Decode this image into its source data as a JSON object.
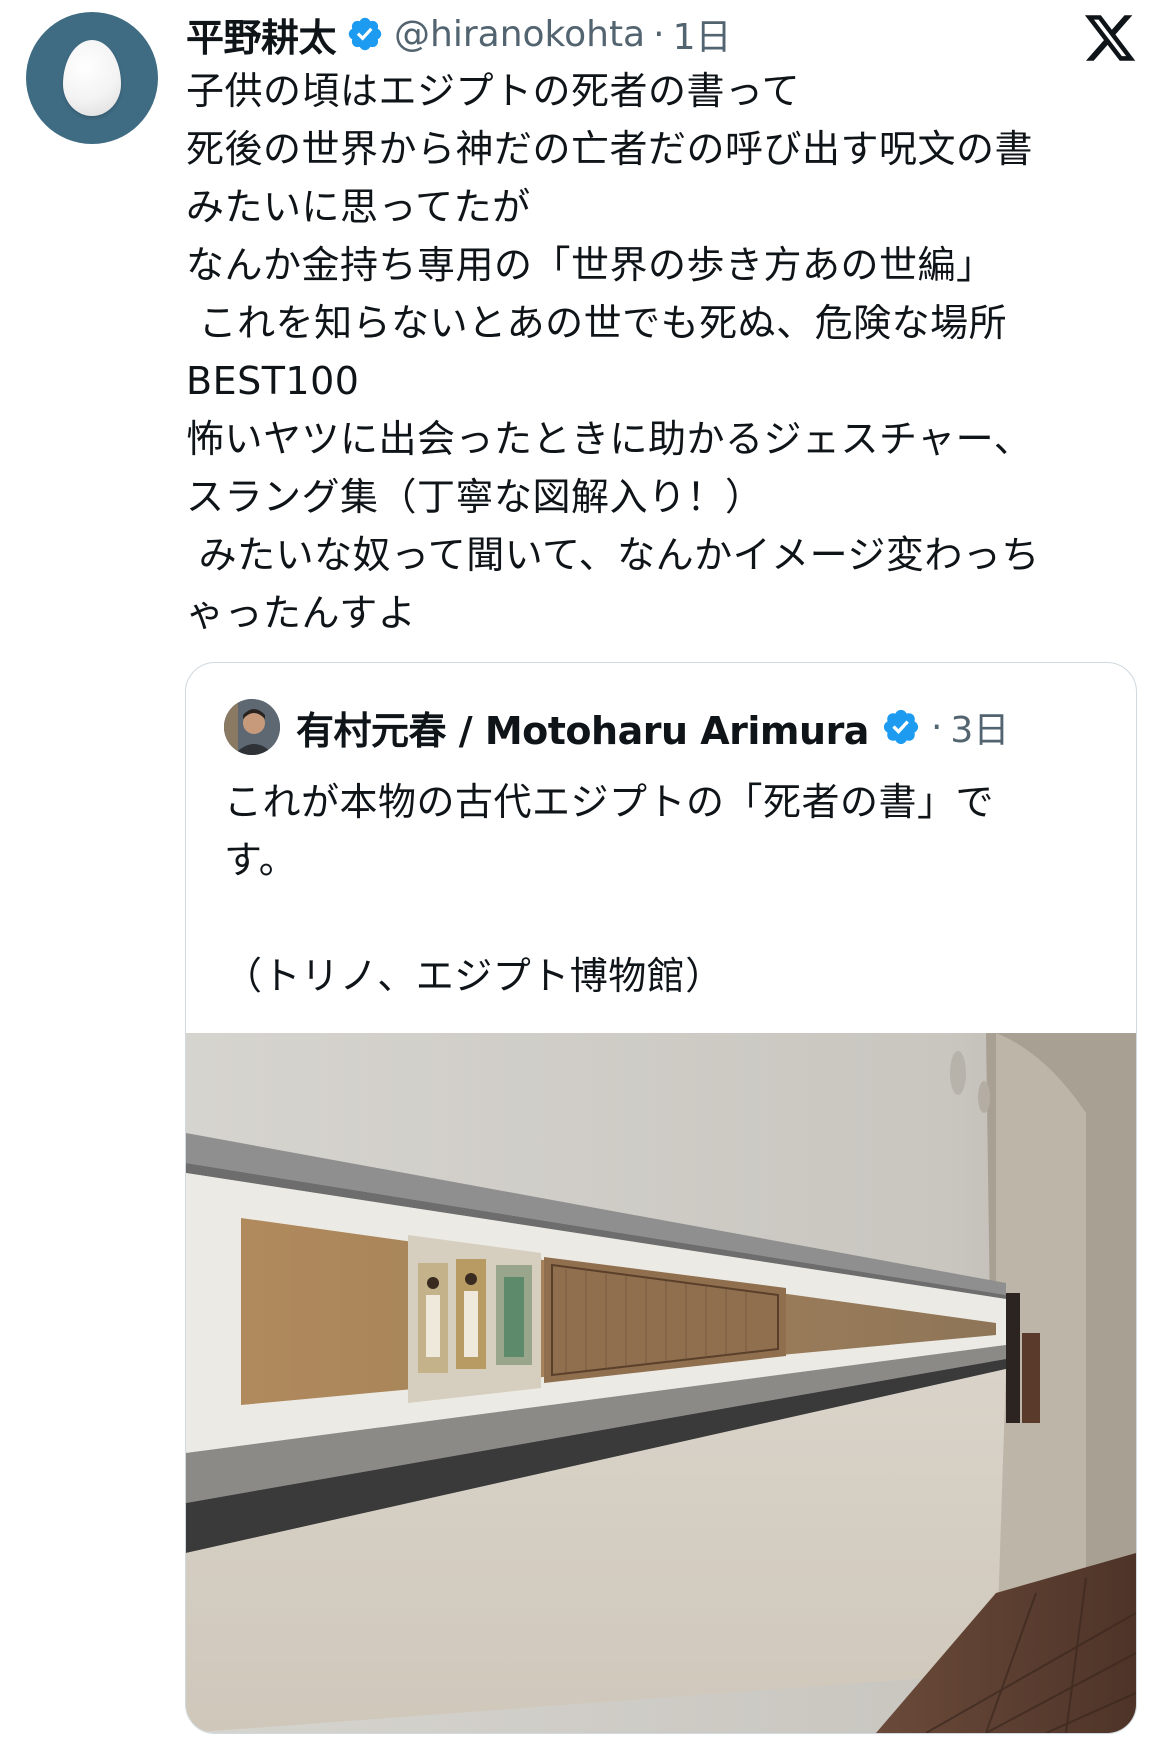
{
  "tweet": {
    "author_name": "平野耕太",
    "author_handle": "@hiranokohta",
    "separator": "·",
    "time": "1日",
    "avatar_icon": "egg-avatar-icon",
    "verified_icon": "verified-badge-icon",
    "platform_icon": "x-logo-icon",
    "text": "子供の頃はエジプトの死者の書って\n死後の世界から神だの亡者だの呼び出す呪文の書\nみたいに思ってたが\nなんか金持ち専用の「世界の歩き方あの世編」\n これを知らないとあの世でも死ぬ、危険な場所\nBEST100\n怖いヤツに出会ったときに助かるジェスチャー、\nスラング集（丁寧な図解入り！）\n みたいな奴って聞いて、なんかイメージ変わっち\nゃったんすよ"
  },
  "quoted": {
    "author_name": "有村元春 / Motoharu Arimura",
    "separator": "·",
    "time": "3日",
    "text": "これが本物の古代エジプトの「死者の書」で\nす。\n\n（トリノ、エジプト博物館）",
    "image_alt": "museum-papyrus-photo"
  },
  "colors": {
    "verified_blue": "#1d9bf0",
    "secondary_text": "#536471",
    "border": "#cfd9de",
    "avatar_bg": "#3f6b83"
  }
}
